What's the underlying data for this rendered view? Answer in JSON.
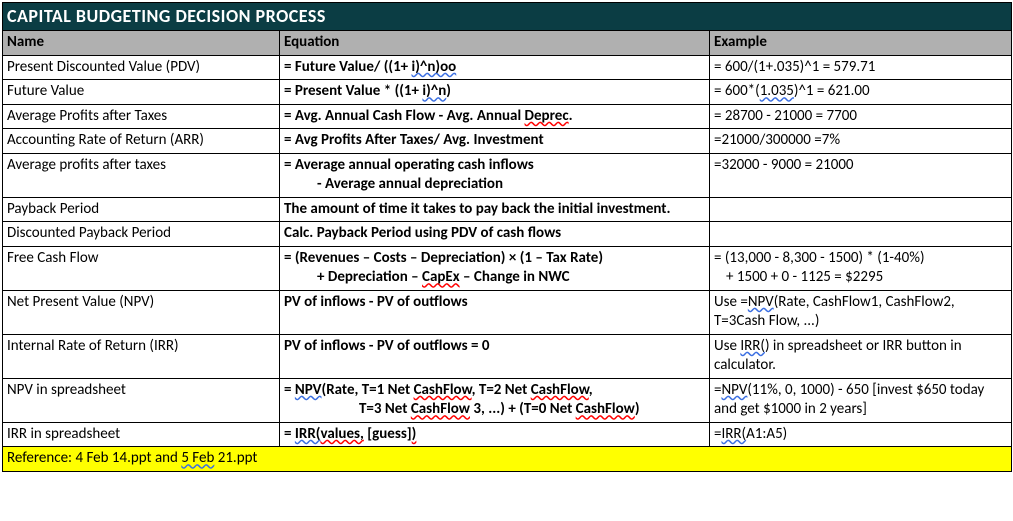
{
  "title": "CAPITAL BUDGETING DECISION PROCESS",
  "headers": {
    "name": "Name",
    "equation": "Equation",
    "example": "Example"
  },
  "rows": {
    "r0": {
      "name": "Present Discounted Value (PDV)",
      "eq_a": "= Future Value/ ((1+ ",
      "eq_b": "i)^n)oo",
      "ex": "= 600/(1+.035)^1 = 579.71"
    },
    "r1": {
      "name": "Future Value",
      "eq_a": "= Present Value * ((1+ ",
      "eq_b": "i)^n",
      "eq_c": ")",
      "ex_a": "= 600*(",
      "ex_b": "1.035",
      "ex_c": ")^1 = 621.00"
    },
    "r2": {
      "name": "Average Profits after Taxes",
      "eq_a": "= Avg. Annual Cash Flow - Avg. Annual ",
      "eq_b": "Deprec",
      "eq_c": ".",
      "ex": "= 28700 - 21000 = 7700"
    },
    "r3": {
      "name": "Accounting Rate of Return (ARR)",
      "eq": "= Avg Profits After Taxes/ Avg. Investment",
      "ex": "=21000/300000 =7%"
    },
    "r4": {
      "name": "Average profits after taxes",
      "eq_l1": "= Average annual operating cash inflows",
      "eq_l2": "- Average annual depreciation",
      "ex": "=32000 - 9000 = 21000"
    },
    "r5": {
      "name": "Payback Period",
      "eq": "The amount of time it takes to pay back the initial investment.",
      "ex": ""
    },
    "r6": {
      "name": "Discounted Payback Period",
      "eq": "Calc. Payback Period using PDV of cash flows",
      "ex": ""
    },
    "r7": {
      "name": "Free Cash Flow",
      "eq_l1": "= (Revenues – Costs – Depreciation) × (1 – Tax Rate)",
      "eq_l2a": "+ Depreciation – ",
      "eq_l2b": "CapEx",
      "eq_l2c": " – Change in NWC",
      "ex_l1": "= (13,000 - 8,300 - 1500) * (1-40%)",
      "ex_l2": "+ 1500 + 0 - 1125 = $2295"
    },
    "r8": {
      "name": "Net Present Value (NPV)",
      "eq": "PV of inflows - PV of outflows",
      "ex_a": "Use =",
      "ex_b": "NPV",
      "ex_c": "(Rate, CashFlow1, CashFlow2, T=3Cash Flow, ...)"
    },
    "r9": {
      "name": "Internal Rate of Return (IRR)",
      "eq": "PV of inflows - PV of outflows = 0",
      "ex_a": "Use ",
      "ex_b": "IRR(",
      "ex_c": ") in spreadsheet or IRR button in calculator."
    },
    "r10": {
      "name": "NPV in spreadsheet",
      "eq_l1a": "= ",
      "eq_l1b": "NPV",
      "eq_l1c": "(Rate, T=1 Net ",
      "eq_l1d": "CashFlow",
      "eq_l1e": ", T=2 Net ",
      "eq_l1f": "CashFlow",
      "eq_l1g": ",",
      "eq_l2a": "T=3 Net ",
      "eq_l2b": "CashFlow",
      "eq_l2c": " 3, ...) + (T=0 Net ",
      "eq_l2d": "CashFlow",
      "eq_l2e": ")",
      "ex_a": "=",
      "ex_b": "NPV",
      "ex_c": "(11%, 0, 1000) - 650 [invest $650 today and get $1000 in 2 years]"
    },
    "r11": {
      "name": "IRR in spreadsheet",
      "eq_a": "= ",
      "eq_b": "IRR(",
      "eq_c": "values,",
      "eq_d": " [guess]",
      "eq_e": ")",
      "ex_a": "=",
      "ex_b": "IRR(",
      "ex_c": "A1:A5)"
    }
  },
  "reference": {
    "pre": "Reference: 4 Feb 14.ppt and ",
    "u": "5  Feb",
    "post": " 21.ppt"
  }
}
